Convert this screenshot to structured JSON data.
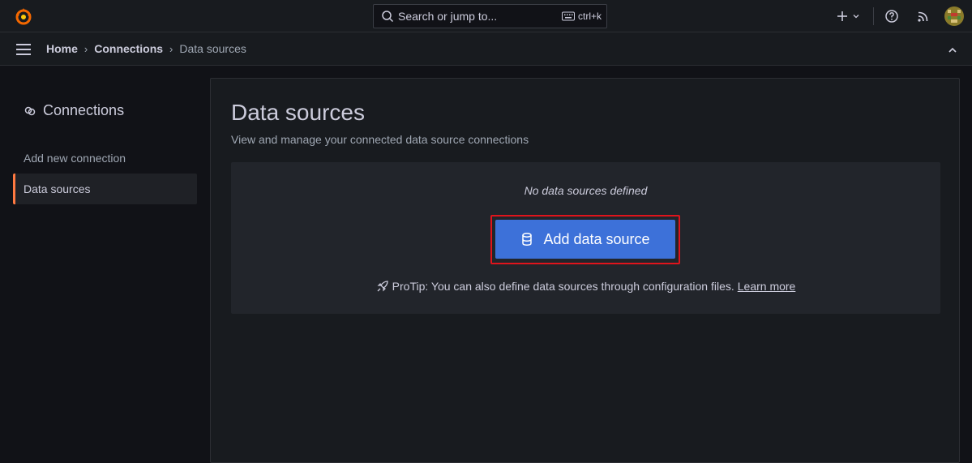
{
  "topbar": {
    "search_placeholder": "Search or jump to...",
    "search_shortcut": "ctrl+k"
  },
  "breadcrumb": {
    "items": [
      "Home",
      "Connections",
      "Data sources"
    ]
  },
  "sidebar": {
    "title": "Connections",
    "items": [
      {
        "label": "Add new connection",
        "active": false
      },
      {
        "label": "Data sources",
        "active": true
      }
    ]
  },
  "main": {
    "title": "Data sources",
    "subtitle": "View and manage your connected data source connections",
    "empty_message": "No data sources defined",
    "add_button_label": "Add data source",
    "protip_text": "ProTip: You can also define data sources through configuration files.",
    "protip_link": "Learn more"
  },
  "colors": {
    "accent": "#3d71d9",
    "active_indicator": "#ff7941",
    "highlight": "#e0141c"
  }
}
